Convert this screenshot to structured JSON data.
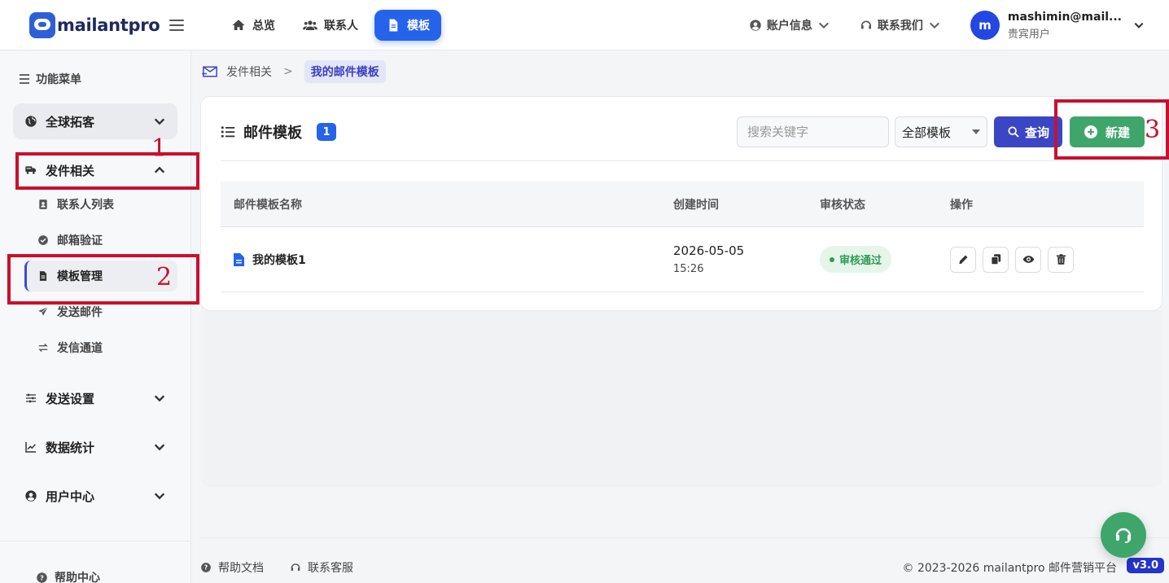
{
  "header": {
    "logo_text": "mailantpro",
    "nav": [
      {
        "label": "总览",
        "icon": "home-icon"
      },
      {
        "label": "联系人",
        "icon": "users-icon"
      },
      {
        "label": "模板",
        "icon": "file-icon",
        "active": true
      }
    ],
    "account_label": "账户信息",
    "contact_label": "联系我们",
    "avatar_letter": "m",
    "user_email": "mashimin@mail...",
    "user_role": "贵宾用户"
  },
  "sidebar": {
    "menu_title": "功能菜单",
    "groups": [
      {
        "label": "全球拓客",
        "icon": "globe-icon"
      },
      {
        "label": "发件相关",
        "icon": "mail-truck-icon"
      },
      {
        "label": "发送设置",
        "icon": "sliders-icon"
      },
      {
        "label": "数据统计",
        "icon": "chart-icon"
      },
      {
        "label": "用户中心",
        "icon": "user-icon"
      }
    ],
    "sub_items": [
      {
        "label": "联系人列表",
        "icon": "address-book-icon"
      },
      {
        "label": "邮箱验证",
        "icon": "check-circle-icon"
      },
      {
        "label": "模板管理",
        "icon": "file-icon",
        "active": true
      },
      {
        "label": "发送邮件",
        "icon": "paper-plane-icon"
      },
      {
        "label": "发信通道",
        "icon": "swap-icon"
      }
    ],
    "help_center": "帮助中心"
  },
  "annotations": [
    {
      "number": "1",
      "color": "#c8102e"
    },
    {
      "number": "2",
      "color": "#c8102e"
    },
    {
      "number": "3",
      "color": "#c8102e"
    }
  ],
  "breadcrumb": {
    "parent": "发件相关",
    "separator": ">",
    "current": "我的邮件模板"
  },
  "card": {
    "title": "邮件模板",
    "count": "1",
    "search_placeholder": "搜索关键字",
    "filter_value": "全部模板",
    "query_label": "查询",
    "new_label": "新建"
  },
  "table": {
    "headers": [
      "邮件模板名称",
      "创建时间",
      "审核状态",
      "操作"
    ],
    "rows": [
      {
        "name": "我的模板1",
        "date": "2026-05-05",
        "time": "15:26",
        "status": "审核通过",
        "actions": [
          "edit-icon",
          "copy-icon",
          "eye-icon",
          "trash-icon"
        ]
      }
    ]
  },
  "footer": {
    "help_docs": "帮助文档",
    "support": "联系客服",
    "copyright": "© 2023-2026 mailantpro 邮件营销平台",
    "version": "v3.0"
  },
  "colors": {
    "primary": "#2563eb",
    "query": "#3b46c4",
    "success": "#3fa66b",
    "annotation": "#c8102e"
  }
}
